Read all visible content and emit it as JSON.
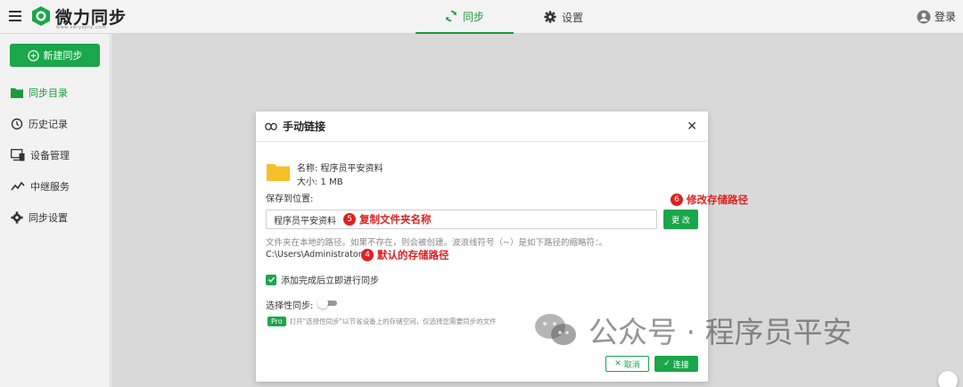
{
  "header": {
    "logo_text": "微力同步",
    "logo_sub": "www.verysync.com",
    "tabs": [
      {
        "label": "同步",
        "icon": "sync-icon",
        "active": true
      },
      {
        "label": "设置",
        "icon": "gear-icon",
        "active": false
      }
    ],
    "login_label": "登录"
  },
  "sidebar": {
    "new_sync_label": "新建同步",
    "items": [
      {
        "label": "同步目录",
        "icon": "folder-icon",
        "active": true
      },
      {
        "label": "历史记录",
        "icon": "history-icon",
        "active": false
      },
      {
        "label": "设备管理",
        "icon": "device-icon",
        "active": false
      },
      {
        "label": "中继服务",
        "icon": "relay-icon",
        "active": false
      },
      {
        "label": "同步设置",
        "icon": "gear-icon",
        "active": false
      }
    ]
  },
  "dialog": {
    "title": "手动链接",
    "name_line": "名称: 程序员平安资料",
    "size_line": "大小: 1 MB",
    "save_to_label": "保存到位置:",
    "path_value": "程序员平安资料",
    "change_button": "更 改",
    "hint": "文件夹在本地的路径。如果不存在，则会被创建。波浪线符号（~）是如下路径的缩略符：。",
    "default_path": "C:\\Users\\Administrator",
    "sync_after_add_label": "添加完成后立即进行同步",
    "sync_after_add_checked": true,
    "selective_label": "选择性同步:",
    "selective_on": false,
    "pro_badge": "Pro",
    "pro_text": "打开\"选择性同步\"以节省设备上的存储空间，仅选择您需要同步的文件",
    "cancel_button": "取消",
    "connect_button": "连接"
  },
  "annotations": [
    {
      "num": "4",
      "text": "默认的存储路径"
    },
    {
      "num": "5",
      "text": "复制文件夹名称"
    },
    {
      "num": "6",
      "text": "修改存储路径"
    }
  ],
  "watermark": {
    "text": "公众号 · 程序员平安"
  },
  "colors": {
    "accent": "#1aa64a",
    "annotation": "#e02020"
  }
}
